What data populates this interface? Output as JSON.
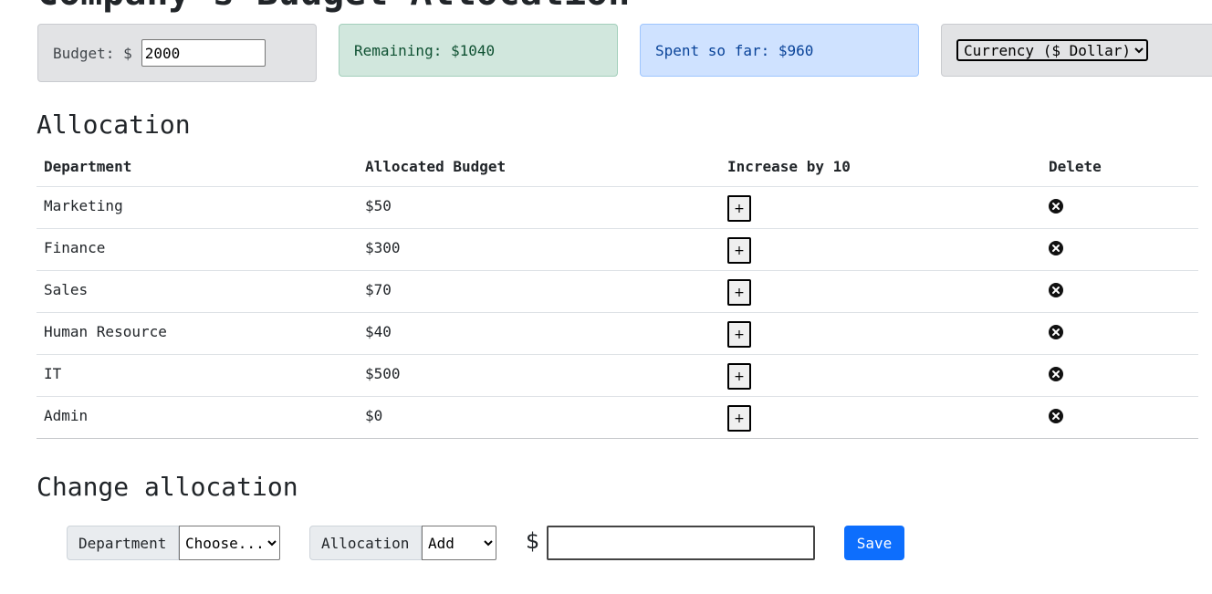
{
  "page": {
    "title": "Company's Budget Allocation"
  },
  "summary": {
    "budget_label": "Budget: $",
    "budget_value": "2000",
    "remaining": "Remaining: $1040",
    "spent": "Spent so far: $960",
    "currency_selected": "Currency ($ Dollar)"
  },
  "allocation": {
    "title": "Allocation",
    "headers": {
      "department": "Department",
      "budget": "Allocated Budget",
      "increase": "Increase by 10",
      "delete": "Delete"
    },
    "increase_label": "+",
    "rows": [
      {
        "department": "Marketing",
        "budget": "$50"
      },
      {
        "department": "Finance",
        "budget": "$300"
      },
      {
        "department": "Sales",
        "budget": "$70"
      },
      {
        "department": "Human Resource",
        "budget": "$40"
      },
      {
        "department": "IT",
        "budget": "$500"
      },
      {
        "department": "Admin",
        "budget": "$0"
      }
    ]
  },
  "change": {
    "title": "Change allocation",
    "department_label": "Department",
    "department_selected": "Choose...",
    "allocation_label": "Allocation",
    "allocation_selected": "Add",
    "currency_symbol": "$",
    "amount_value": "",
    "save_label": "Save"
  },
  "colors": {
    "remaining_bg": "#d1e7dd",
    "spent_bg": "#cfe2ff",
    "neutral_bg": "#e2e3e5",
    "save_button": "#0d6efd"
  },
  "icons": {
    "delete": "circle-x-icon"
  }
}
